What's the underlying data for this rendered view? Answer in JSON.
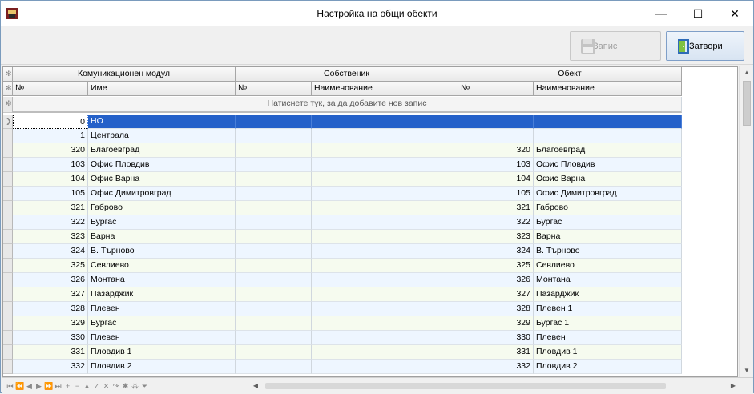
{
  "window": {
    "title": "Настройка на общи обекти",
    "minimize_glyph": "—",
    "maximize_glyph": "☐",
    "close_glyph": "✕"
  },
  "toolbar": {
    "save_label": "Запис",
    "close_label": "Затвори",
    "save_icon": "floppy-disk-icon",
    "close_icon": "exit-door-icon"
  },
  "grid": {
    "bands": [
      "Комуникационен модул",
      "Собственик",
      "Обект"
    ],
    "columns": [
      "№",
      "Име",
      "№",
      "Наименование",
      "№",
      "Наименование"
    ],
    "new_row_text": "Натиснете тук, за да добавите нов запис",
    "rows": [
      {
        "no": "0",
        "name": "НО",
        "owner_no": "",
        "owner_name": "",
        "obj_no": "",
        "obj_name": ""
      },
      {
        "no": "1",
        "name": "Централа",
        "owner_no": "",
        "owner_name": "",
        "obj_no": "",
        "obj_name": ""
      },
      {
        "no": "320",
        "name": "Благоевград",
        "owner_no": "",
        "owner_name": "",
        "obj_no": "320",
        "obj_name": "Благоевград"
      },
      {
        "no": "103",
        "name": "Офис Пловдив",
        "owner_no": "",
        "owner_name": "",
        "obj_no": "103",
        "obj_name": "Офис Пловдив"
      },
      {
        "no": "104",
        "name": "Офис Варна",
        "owner_no": "",
        "owner_name": "",
        "obj_no": "104",
        "obj_name": "Офис Варна"
      },
      {
        "no": "105",
        "name": "Офис Димитровград",
        "owner_no": "",
        "owner_name": "",
        "obj_no": "105",
        "obj_name": "Офис Димитровград"
      },
      {
        "no": "321",
        "name": "Габрово",
        "owner_no": "",
        "owner_name": "",
        "obj_no": "321",
        "obj_name": "Габрово"
      },
      {
        "no": "322",
        "name": "Бургас",
        "owner_no": "",
        "owner_name": "",
        "obj_no": "322",
        "obj_name": "Бургас"
      },
      {
        "no": "323",
        "name": "Варна",
        "owner_no": "",
        "owner_name": "",
        "obj_no": "323",
        "obj_name": "Варна"
      },
      {
        "no": "324",
        "name": "В. Търново",
        "owner_no": "",
        "owner_name": "",
        "obj_no": "324",
        "obj_name": "В. Търново"
      },
      {
        "no": "325",
        "name": "Севлиево",
        "owner_no": "",
        "owner_name": "",
        "obj_no": "325",
        "obj_name": "Севлиево"
      },
      {
        "no": "326",
        "name": "Монтана",
        "owner_no": "",
        "owner_name": "",
        "obj_no": "326",
        "obj_name": "Монтана"
      },
      {
        "no": "327",
        "name": "Пазарджик",
        "owner_no": "",
        "owner_name": "",
        "obj_no": "327",
        "obj_name": "Пазарджик"
      },
      {
        "no": "328",
        "name": "Плевен",
        "owner_no": "",
        "owner_name": "",
        "obj_no": "328",
        "obj_name": "Плевен 1"
      },
      {
        "no": "329",
        "name": "Бургас",
        "owner_no": "",
        "owner_name": "",
        "obj_no": "329",
        "obj_name": "Бургас 1"
      },
      {
        "no": "330",
        "name": "Плевен",
        "owner_no": "",
        "owner_name": "",
        "obj_no": "330",
        "obj_name": "Плевен"
      },
      {
        "no": "331",
        "name": "Пловдив 1",
        "owner_no": "",
        "owner_name": "",
        "obj_no": "331",
        "obj_name": "Пловдив 1"
      },
      {
        "no": "332",
        "name": "Пловдив 2",
        "owner_no": "",
        "owner_name": "",
        "obj_no": "332",
        "obj_name": "Пловдив 2"
      }
    ]
  },
  "navigator": {
    "buttons": [
      {
        "name": "first-page",
        "glyph": "⏮"
      },
      {
        "name": "prev-page",
        "glyph": "⏪"
      },
      {
        "name": "prev-record",
        "glyph": "◀"
      },
      {
        "name": "next-record",
        "glyph": "▶"
      },
      {
        "name": "next-page",
        "glyph": "⏩"
      },
      {
        "name": "last-page",
        "glyph": "⏭"
      },
      {
        "name": "append",
        "glyph": "+"
      },
      {
        "name": "delete",
        "glyph": "−"
      },
      {
        "name": "edit",
        "glyph": "▲"
      },
      {
        "name": "post",
        "glyph": "✓"
      },
      {
        "name": "cancel",
        "glyph": "✕"
      },
      {
        "name": "refresh",
        "glyph": "↷"
      },
      {
        "name": "bookmark",
        "glyph": "✱"
      },
      {
        "name": "goto-bookmark",
        "glyph": "⁂"
      },
      {
        "name": "filter",
        "glyph": "⏷"
      }
    ]
  }
}
